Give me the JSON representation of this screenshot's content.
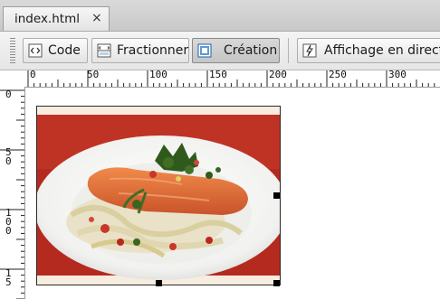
{
  "document_tab": {
    "title": "index.html",
    "close_glyph": "×"
  },
  "toolbar": {
    "buttons": [
      {
        "label": "Code",
        "icon": "code-view-icon"
      },
      {
        "label": "Fractionner",
        "icon": "split-view-icon"
      },
      {
        "label": "Création",
        "icon": "design-view-icon",
        "active": true
      },
      {
        "label": "Affichage en direct",
        "icon": "live-view-icon"
      }
    ]
  },
  "ruler": {
    "h_labels": [
      "0",
      "50",
      "100",
      "150",
      "200",
      "250",
      "300"
    ],
    "v_labels": [
      "0",
      "5 0",
      "1 0 0",
      "1 5"
    ]
  },
  "image": {
    "description_icon": "salmon-dish-image"
  }
}
